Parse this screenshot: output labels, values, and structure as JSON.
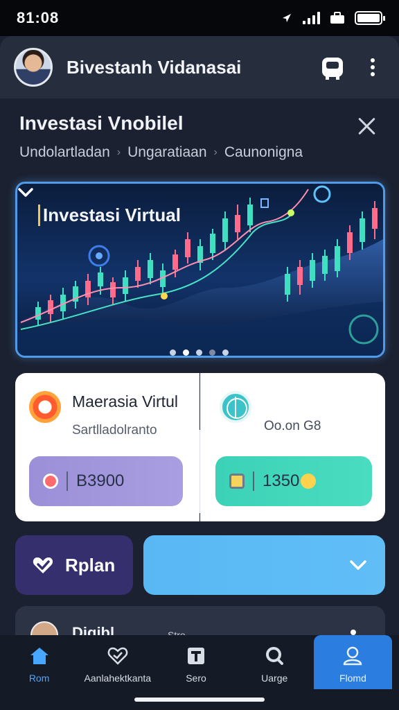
{
  "status": {
    "time": "81:08"
  },
  "header": {
    "title": "Bivestanh Vidanasai"
  },
  "page": {
    "title": "Investasi Vnobilel",
    "breadcrumb": [
      "Undolartladan",
      "Ungaratiaan",
      "Caunonigna"
    ]
  },
  "banner": {
    "title": "Investasi Virtual",
    "slides": 5,
    "active_slide": 1
  },
  "cards": {
    "left": {
      "title": "Maerasia Virtul",
      "subtitle": "Sartlladolranto",
      "button_value": "B3900"
    },
    "right": {
      "value": "Oo.on G8",
      "button_value": "1350"
    }
  },
  "plan": {
    "label": "Rplan"
  },
  "peek": {
    "title": "Digibl",
    "sub": "Stro"
  },
  "nav": {
    "items": [
      {
        "label": "Rom"
      },
      {
        "label": "Aanlahektkanta"
      },
      {
        "label": "Sero"
      },
      {
        "label": "Uarge"
      },
      {
        "label": "Flomd"
      }
    ]
  },
  "colors": {
    "accent": "#2b7de0",
    "banner_border": "#4f9be8",
    "plan": "#362f6e",
    "teal": "#3cd2b7",
    "lilac": "#9b8fd8"
  }
}
